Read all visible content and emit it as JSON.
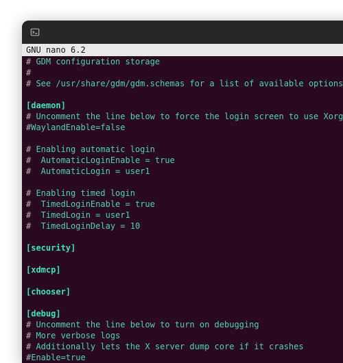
{
  "window": {
    "titlebar_icon": "terminal-icon"
  },
  "nano": {
    "header": "  GNU nano 6.2"
  },
  "file": {
    "lines": [
      {
        "prefix": "#",
        "text": " GDM configuration storage"
      },
      {
        "prefix": "#",
        "text": ""
      },
      {
        "prefix": "#",
        "text": " See /usr/share/gdm/gdm.schemas for a list of available options."
      },
      {
        "prefix": "",
        "text": ""
      },
      {
        "prefix": "",
        "text": "[daemon]",
        "bold": true
      },
      {
        "prefix": "#",
        "text": " Uncomment the line below to force the login screen to use Xorg"
      },
      {
        "prefix": "#",
        "text": "WaylandEnable=false"
      },
      {
        "prefix": "",
        "text": ""
      },
      {
        "prefix": "#",
        "text": " Enabling automatic login"
      },
      {
        "prefix": "#",
        "text": "  AutomaticLoginEnable = true"
      },
      {
        "prefix": "#",
        "text": "  AutomaticLogin = user1"
      },
      {
        "prefix": "",
        "text": ""
      },
      {
        "prefix": "#",
        "text": " Enabling timed login"
      },
      {
        "prefix": "#",
        "text": "  TimedLoginEnable = true"
      },
      {
        "prefix": "#",
        "text": "  TimedLogin = user1"
      },
      {
        "prefix": "#",
        "text": "  TimedLoginDelay = 10"
      },
      {
        "prefix": "",
        "text": ""
      },
      {
        "prefix": "",
        "text": "[security]",
        "bold": true
      },
      {
        "prefix": "",
        "text": ""
      },
      {
        "prefix": "",
        "text": "[xdmcp]",
        "bold": true
      },
      {
        "prefix": "",
        "text": ""
      },
      {
        "prefix": "",
        "text": "[chooser]",
        "bold": true
      },
      {
        "prefix": "",
        "text": ""
      },
      {
        "prefix": "",
        "text": "[debug]",
        "bold": true
      },
      {
        "prefix": "#",
        "text": " Uncomment the line below to turn on debugging"
      },
      {
        "prefix": "#",
        "text": " More verbose logs"
      },
      {
        "prefix": "#",
        "text": " Additionally lets the X server dump core if it crashes"
      },
      {
        "prefix": "#",
        "text": "Enable=true"
      }
    ]
  }
}
